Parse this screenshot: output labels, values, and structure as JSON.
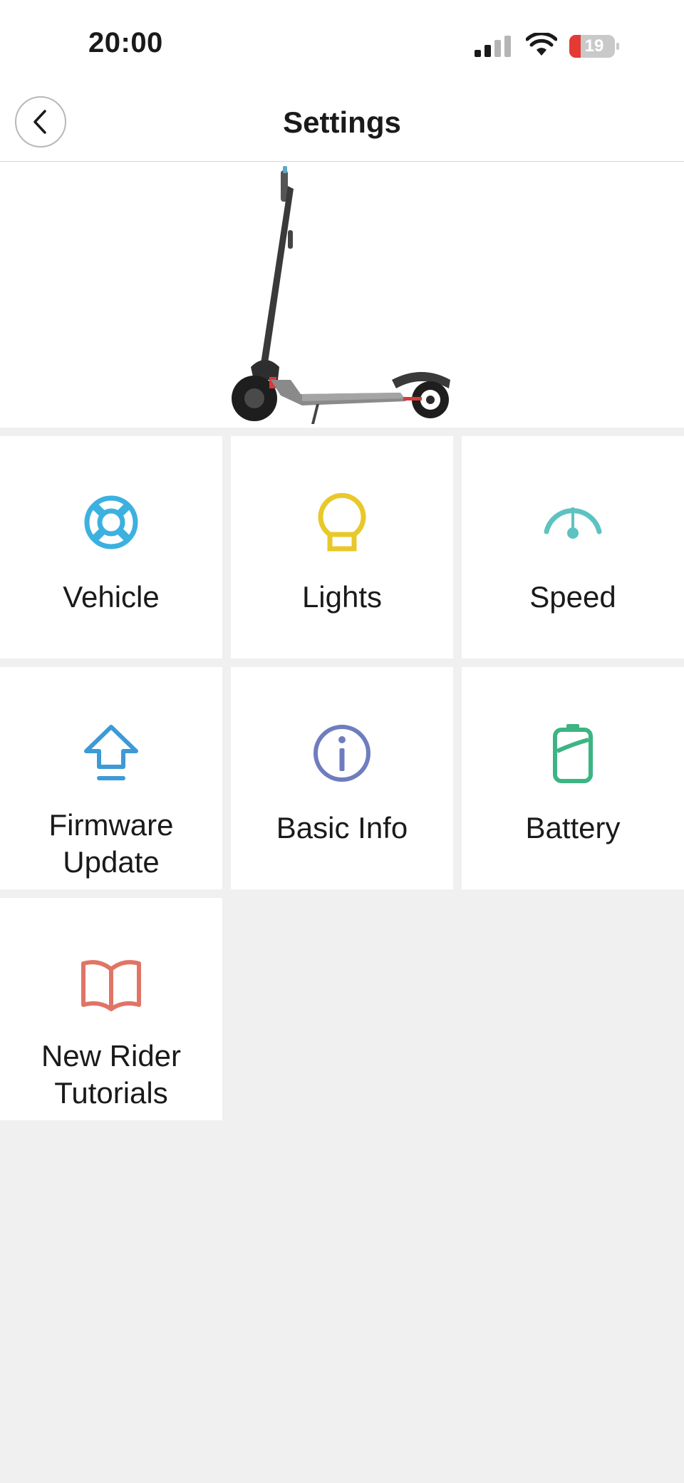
{
  "status_bar": {
    "time": "20:00",
    "battery_level": "19",
    "icons": [
      "signal-icon",
      "wifi-icon",
      "battery-icon"
    ]
  },
  "header": {
    "title": "Settings",
    "back_icon": "chevron-left-icon"
  },
  "hero": {
    "image": "scooter-image"
  },
  "menu": {
    "items": [
      {
        "label": "Vehicle",
        "icon": "lifebuoy-icon",
        "color": "#3cb1e0"
      },
      {
        "label": "Lights",
        "icon": "lightbulb-icon",
        "color": "#e8c82a"
      },
      {
        "label": "Speed",
        "icon": "speedometer-icon",
        "color": "#5cc3c0"
      },
      {
        "label": "Firmware Update",
        "icon": "upload-arrow-icon",
        "color": "#3c9ad6"
      },
      {
        "label": "Basic Info",
        "icon": "info-icon",
        "color": "#6f7dbe"
      },
      {
        "label": "Battery",
        "icon": "battery-icon",
        "color": "#3cb483"
      },
      {
        "label": "New Rider Tutorials",
        "icon": "book-icon",
        "color": "#e07566"
      }
    ]
  },
  "colors": {
    "background": "#f0f0f0",
    "surface": "#ffffff",
    "battery_low": "#e53935"
  }
}
